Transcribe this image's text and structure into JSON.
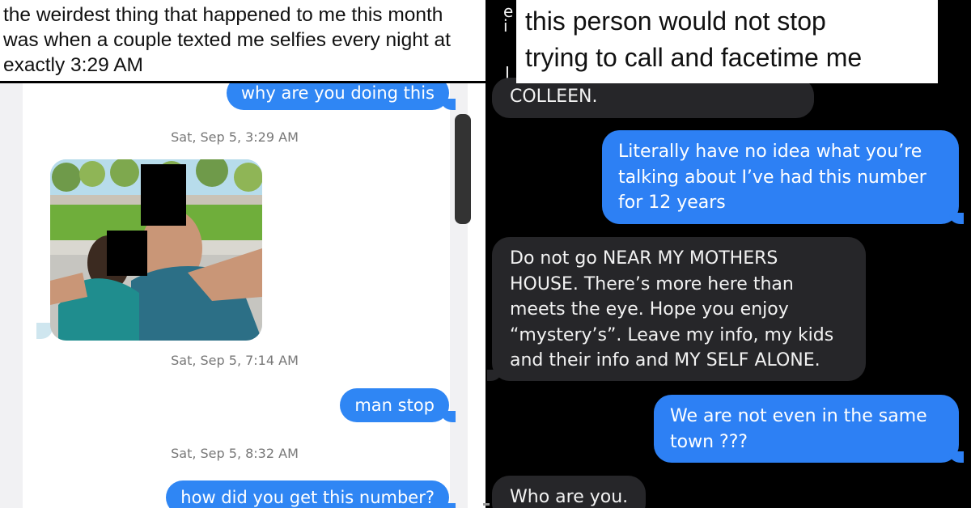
{
  "left_panel": {
    "caption_lines": [
      "the weirdest thing that happened to me this month",
      "was when a couple texted me selfies every night at",
      "exactly 3:29 AM"
    ],
    "messages": {
      "m1": "why are you doing this",
      "ts1": "Sat, Sep 5, 3:29 AM",
      "ts2": "Sat, Sep 5, 7:14 AM",
      "m2": "man stop",
      "ts3": "Sat, Sep 5, 8:32 AM",
      "m3": "how did you get this number?"
    },
    "photo_description_icon": "selfie-photo",
    "colors": {
      "bubble": "#2f86f4",
      "timestamp": "#777777",
      "pane": "#ffffff"
    }
  },
  "right_panel": {
    "caption_lines": [
      "this person would not stop",
      "trying to call and facetime me"
    ],
    "fragments": {
      "f1": "i",
      "f2": "I",
      "f3": "e"
    },
    "messages": {
      "g1": "COLLEEN.",
      "b1_lines": [
        "Literally have no idea what you’re",
        "talking about I’ve had this number",
        "for 12 years"
      ],
      "g2_lines": [
        "Do not go NEAR MY MOTHERS",
        "HOUSE. There’s more here than",
        "meets the eye. Hope you enjoy",
        "“mystery’s”. Leave my info, my kids",
        "and their info and MY SELF ALONE."
      ],
      "b2_lines": [
        "We are not even in the same",
        "town ???"
      ],
      "g3": "Who are you."
    },
    "colors": {
      "background": "#000000",
      "incoming": "#262629",
      "outgoing": "#2d80f4"
    }
  }
}
